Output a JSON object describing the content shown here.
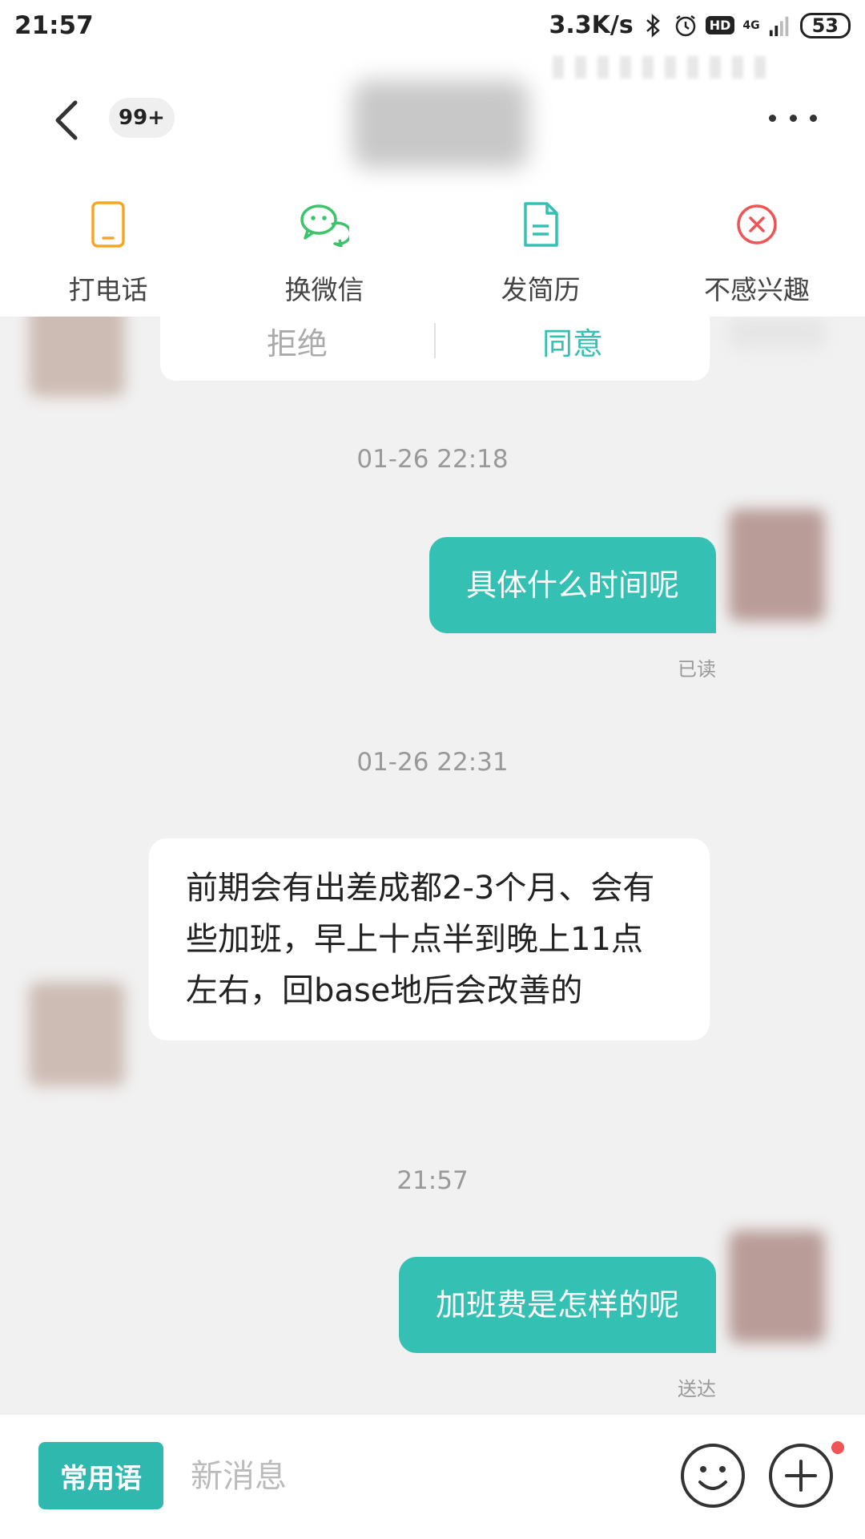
{
  "status_bar": {
    "time": "21:57",
    "net_speed": "3.3K/s",
    "hd": "HD",
    "network": "4G",
    "battery": "53"
  },
  "header": {
    "unread_count": "99+"
  },
  "actions": [
    {
      "label": "打电话",
      "icon": "phone-icon",
      "color": "#f5a623"
    },
    {
      "label": "换微信",
      "icon": "wechat-icon",
      "color": "#3cc46a"
    },
    {
      "label": "发简历",
      "icon": "document-icon",
      "color": "#35c0b4"
    },
    {
      "label": "不感兴趣",
      "icon": "close-circle-icon",
      "color": "#f05454"
    }
  ],
  "request_card": {
    "reject_label": "拒绝",
    "accept_label": "同意"
  },
  "messages": [
    {
      "timestamp": "01-26 22:18",
      "text": "具体什么时间呢",
      "status": "已读"
    },
    {
      "timestamp": "01-26 22:31",
      "text": "前期会有出差成都2-3个月、会有些加班，早上十点半到晚上11点左右，回base地后会改善的"
    },
    {
      "timestamp": "21:57",
      "text": "加班费是怎样的呢",
      "status": "送达"
    }
  ],
  "input_bar": {
    "phrase_label": "常用语",
    "placeholder": "新消息"
  },
  "colors": {
    "accent": "#35c0b4",
    "background": "#f1f1f1"
  }
}
